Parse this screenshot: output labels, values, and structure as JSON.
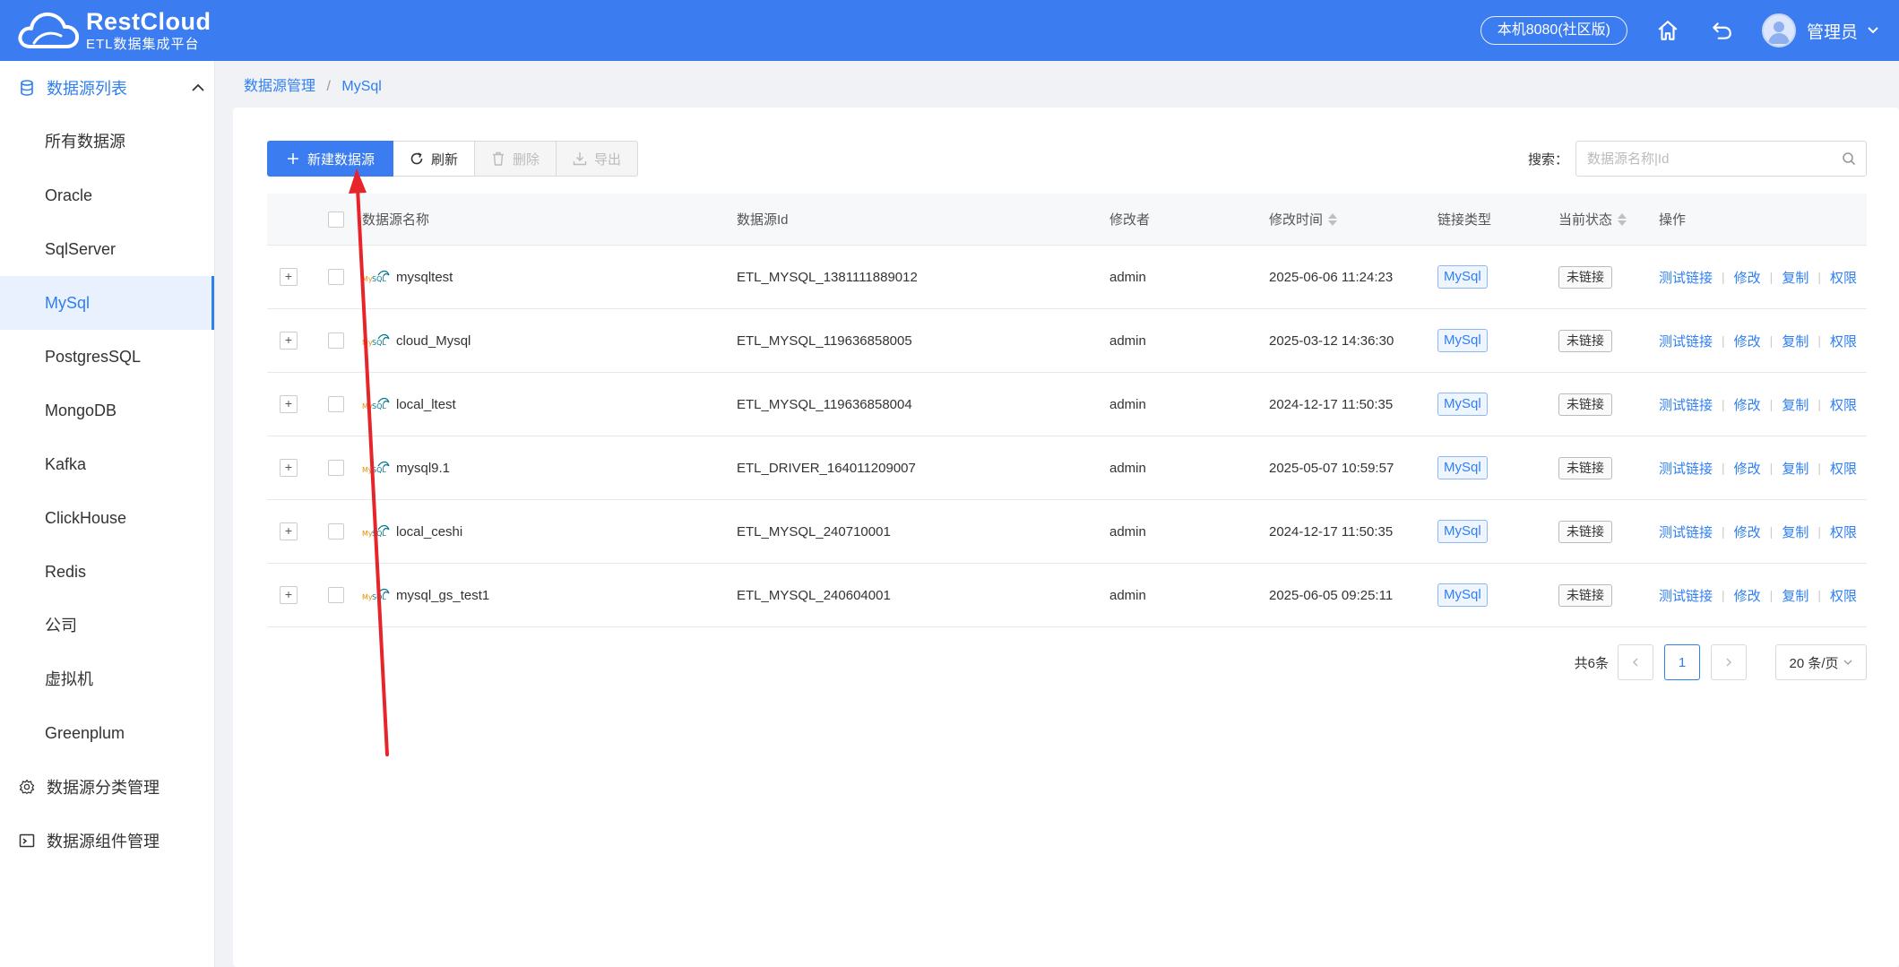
{
  "header": {
    "logo_title": "RestCloud",
    "logo_subtitle": "ETL数据集成平台",
    "env_badge": "本机8080(社区版)",
    "user_name": "管理员"
  },
  "sidebar": {
    "group_datasources": "数据源列表",
    "items": [
      {
        "label": "所有数据源",
        "active": false
      },
      {
        "label": "Oracle",
        "active": false
      },
      {
        "label": "SqlServer",
        "active": false
      },
      {
        "label": "MySql",
        "active": true
      },
      {
        "label": "PostgresSQL",
        "active": false
      },
      {
        "label": "MongoDB",
        "active": false
      },
      {
        "label": "Kafka",
        "active": false
      },
      {
        "label": "ClickHouse",
        "active": false
      },
      {
        "label": "Redis",
        "active": false
      },
      {
        "label": "公司",
        "active": false
      },
      {
        "label": "虚拟机",
        "active": false
      },
      {
        "label": "Greenplum",
        "active": false
      }
    ],
    "group_category": "数据源分类管理",
    "group_component": "数据源组件管理"
  },
  "breadcrumb": {
    "root": "数据源管理",
    "sep": "/",
    "current": "MySql"
  },
  "toolbar": {
    "new_label": "新建数据源",
    "refresh_label": "刷新",
    "delete_label": "删除",
    "export_label": "导出"
  },
  "search": {
    "label": "搜索：",
    "placeholder": "数据源名称|Id"
  },
  "table": {
    "columns": {
      "name": "数据源名称",
      "id": "数据源Id",
      "modifier": "修改者",
      "time": "修改时间",
      "type": "链接类型",
      "state": "当前状态",
      "ops": "操作"
    },
    "ops": {
      "test": "测试链接",
      "edit": "修改",
      "copy": "复制",
      "perm": "权限"
    },
    "rows": [
      {
        "name": "mysqltest",
        "id": "ETL_MYSQL_1381111889012",
        "modifier": "admin",
        "time": "2025-06-06 11:24:23",
        "type": "MySql",
        "state": "未链接"
      },
      {
        "name": "cloud_Mysql",
        "id": "ETL_MYSQL_119636858005",
        "modifier": "admin",
        "time": "2025-03-12 14:36:30",
        "type": "MySql",
        "state": "未链接"
      },
      {
        "name": "local_ltest",
        "id": "ETL_MYSQL_119636858004",
        "modifier": "admin",
        "time": "2024-12-17 11:50:35",
        "type": "MySql",
        "state": "未链接"
      },
      {
        "name": "mysql9.1",
        "id": "ETL_DRIVER_164011209007",
        "modifier": "admin",
        "time": "2025-05-07 10:59:57",
        "type": "MySql",
        "state": "未链接"
      },
      {
        "name": "local_ceshi",
        "id": "ETL_MYSQL_240710001",
        "modifier": "admin",
        "time": "2024-12-17 11:50:35",
        "type": "MySql",
        "state": "未链接"
      },
      {
        "name": "mysql_gs_test1",
        "id": "ETL_MYSQL_240604001",
        "modifier": "admin",
        "time": "2025-06-05 09:25:11",
        "type": "MySql",
        "state": "未链接"
      }
    ]
  },
  "pager": {
    "total": "共6条",
    "current_page": "1",
    "page_size": "20 条/页"
  },
  "colors": {
    "primary": "#3b7cf0",
    "link": "#2f7ff0",
    "annotation_arrow": "#e8242b"
  }
}
